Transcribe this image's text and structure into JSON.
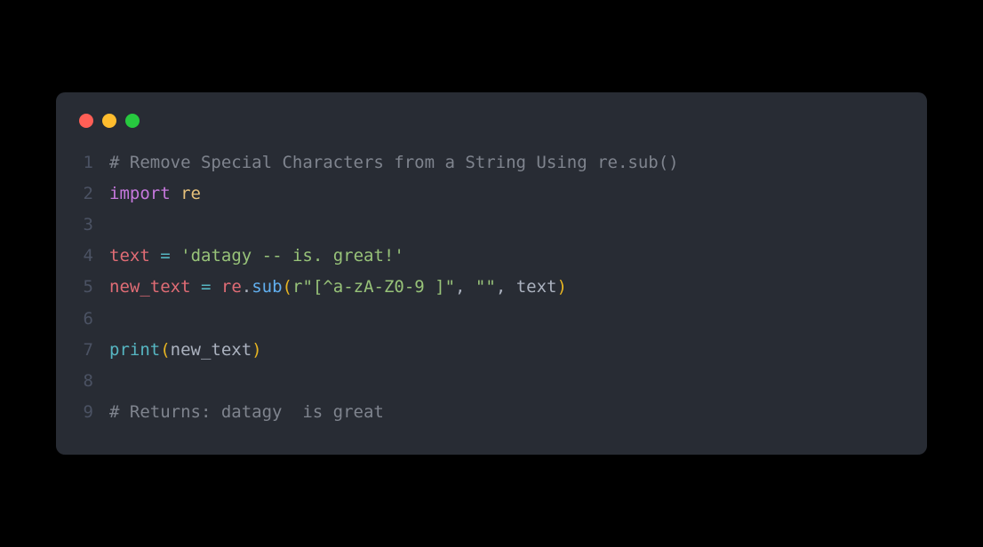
{
  "window": {
    "traffic": {
      "red": "close",
      "yellow": "minimize",
      "green": "zoom"
    }
  },
  "code": {
    "line1": {
      "num": "1",
      "comment": "# Remove Special Characters from a String Using re.sub()"
    },
    "line2": {
      "num": "2",
      "import_kw": "import",
      "space": " ",
      "module": "re"
    },
    "line3": {
      "num": "3",
      "content": ""
    },
    "line4": {
      "num": "4",
      "var": "text",
      "sp1": " ",
      "eq": "=",
      "sp2": " ",
      "str": "'datagy -- is. great!'"
    },
    "line5": {
      "num": "5",
      "var": "new_text",
      "sp1": " ",
      "eq": "=",
      "sp2": " ",
      "mod": "re",
      "dot": ".",
      "fn": "sub",
      "lp": "(",
      "arg1": "r\"[^a-zA-Z0-9 ]\"",
      "c1": ", ",
      "arg2": "\"\"",
      "c2": ", ",
      "arg3": "text",
      "rp": ")"
    },
    "line6": {
      "num": "6",
      "content": ""
    },
    "line7": {
      "num": "7",
      "fn": "print",
      "lp": "(",
      "arg": "new_text",
      "rp": ")"
    },
    "line8": {
      "num": "8",
      "content": ""
    },
    "line9": {
      "num": "9",
      "comment": "# Returns: datagy  is great"
    }
  }
}
